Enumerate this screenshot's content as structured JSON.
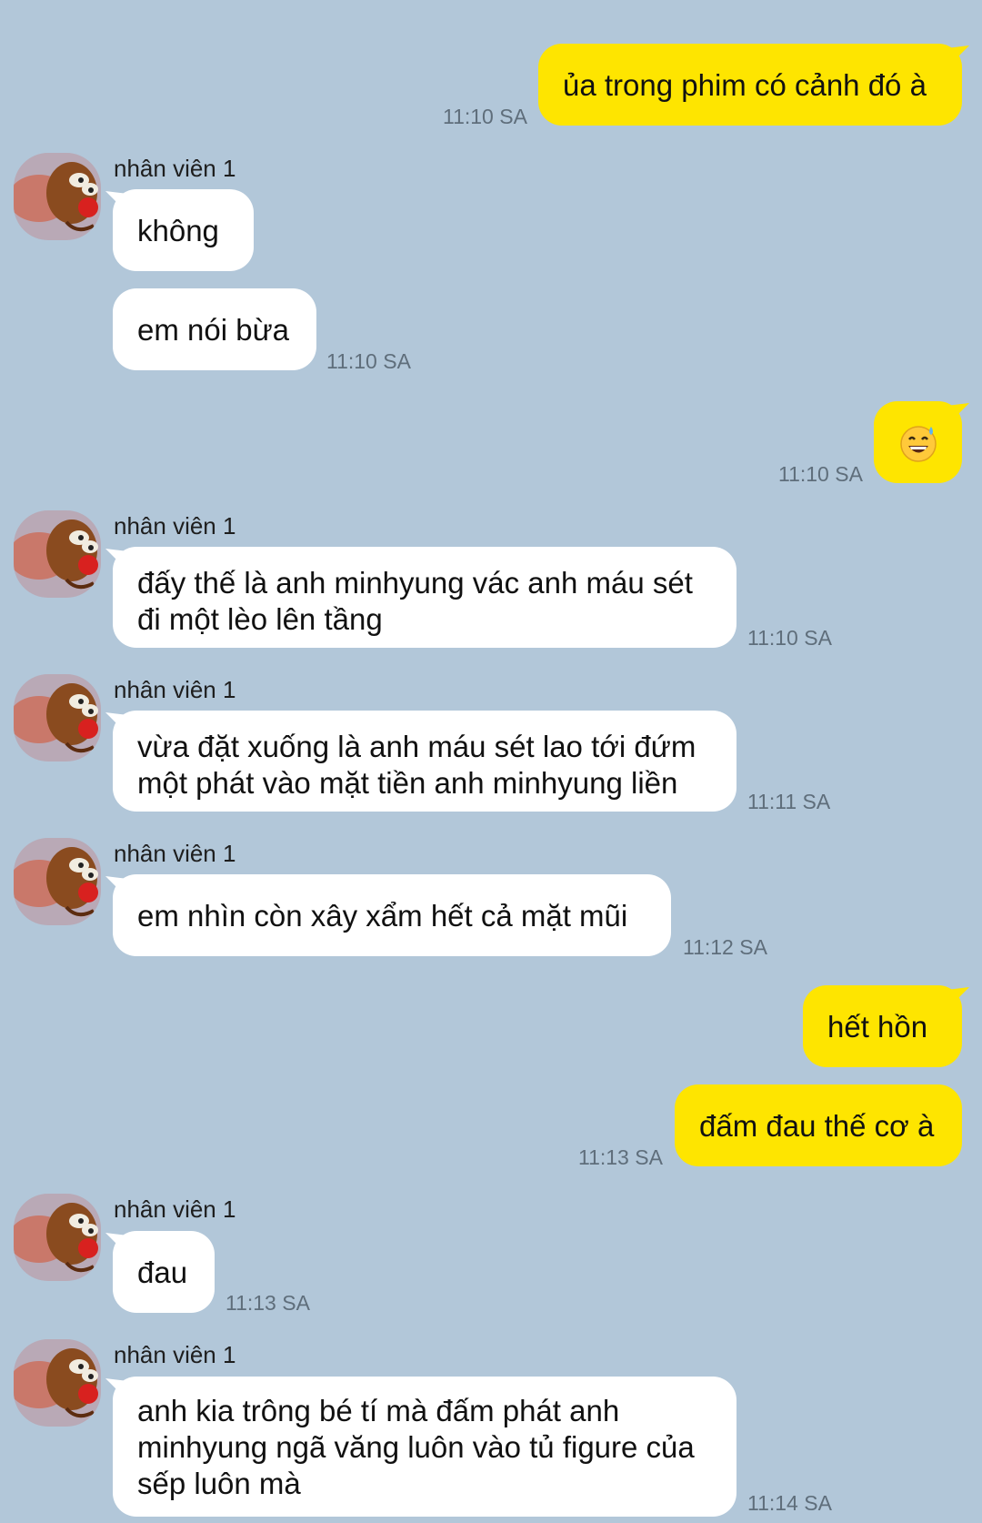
{
  "contact_name": "nhân viên 1",
  "avatar_icon": "cartoon-mouse-avatar-icon",
  "emoji_icon": "grinning-face-with-sweat-icon",
  "colors": {
    "background": "#b2c7d9",
    "incoming_bubble": "#ffffff",
    "outgoing_bubble": "#fee500",
    "timestamp": "#5f6e7b"
  },
  "messages": [
    {
      "id": "m1",
      "sender": "me",
      "text": "ủa trong phim có cảnh đó à",
      "time": "11:10 SA"
    },
    {
      "id": "m2",
      "sender": "nhân viên 1",
      "text": "không",
      "time": ""
    },
    {
      "id": "m3",
      "sender": "nhân viên 1",
      "text": "em nói bừa",
      "time": "11:10 SA"
    },
    {
      "id": "m4",
      "sender": "me",
      "text": "😅",
      "time": "11:10 SA"
    },
    {
      "id": "m5",
      "sender": "nhân viên 1",
      "text": "đấy thế là anh minhyung vác anh máu sét đi một lèo lên tầng",
      "time": "11:10 SA"
    },
    {
      "id": "m6",
      "sender": "nhân viên 1",
      "text": "vừa đặt xuống là anh máu sét lao tới đứm một phát vào mặt tiền anh minhyung liền",
      "time": "11:11 SA"
    },
    {
      "id": "m7",
      "sender": "nhân viên 1",
      "text": "em nhìn còn xây xẩm hết cả mặt mũi",
      "time": "11:12 SA"
    },
    {
      "id": "m8",
      "sender": "me",
      "text": "hết hồn",
      "time": ""
    },
    {
      "id": "m9",
      "sender": "me",
      "text": "đấm đau thế cơ à",
      "time": "11:13 SA"
    },
    {
      "id": "m10",
      "sender": "nhân viên 1",
      "text": "đau",
      "time": "11:13 SA"
    },
    {
      "id": "m11",
      "sender": "nhân viên 1",
      "text": "anh kia trông bé tí mà đấm phát anh minhyung ngã văng luôn vào tủ figure của sếp luôn mà",
      "time": "11:14 SA"
    }
  ]
}
